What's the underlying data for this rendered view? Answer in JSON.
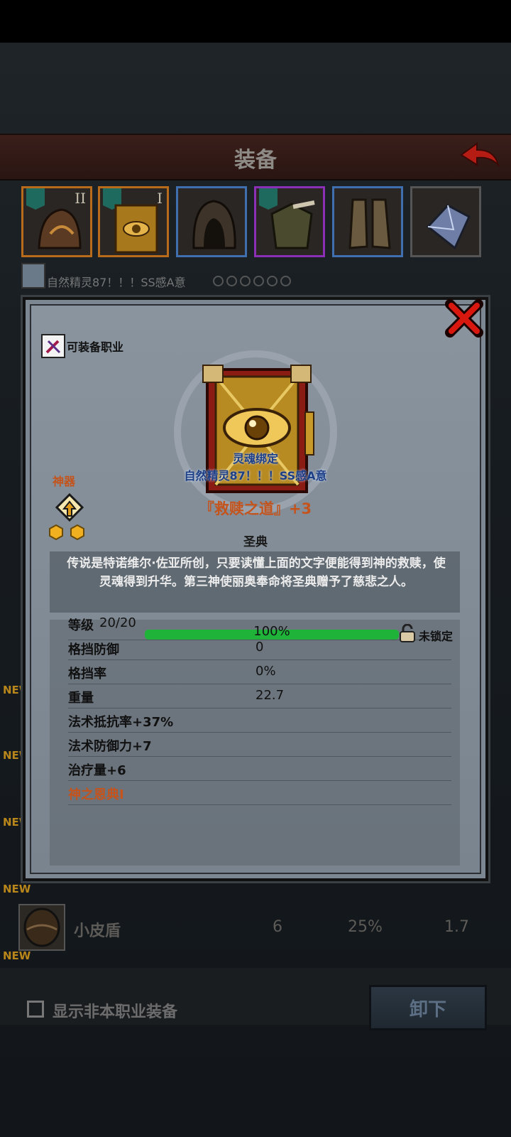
{
  "screen": {
    "title": "装备",
    "owner": {
      "name": "自然精灵87！！！SS感A意"
    }
  },
  "equipment_slots": [
    {
      "name": "helmet",
      "roman": "II",
      "border": "#b86b1a"
    },
    {
      "name": "book",
      "roman": "I",
      "border": "#b86b1a"
    },
    {
      "name": "hood",
      "roman": "",
      "border": "#3f6fae"
    },
    {
      "name": "armor",
      "roman": "",
      "border": "#8a2fb6"
    },
    {
      "name": "boots",
      "roman": "",
      "border": "#3f6fae"
    },
    {
      "name": "crystal",
      "roman": "",
      "border": "#555555"
    }
  ],
  "item": {
    "class_label": "可装备职业",
    "soulbind_label": "灵魂绑定",
    "soulbind_owner": "自然精灵87！！！SS感A意",
    "artifact_label": "神器",
    "name": "『救赎之道』+3",
    "type": "圣典",
    "description": "传说是特诺维尔·佐亚所创，只要读懂上面的文字便能得到神的救赎，使灵魂得到升华。第三神使丽奥奉命将圣典赠予了慈悲之人。",
    "level": {
      "label": "等级",
      "value": "20/20",
      "percent_text": "100%",
      "progress": 1.0,
      "lock_label": "未锁定"
    },
    "stats": [
      {
        "label": "格挡防御",
        "value": "0"
      },
      {
        "label": "格挡率",
        "value": "0%"
      },
      {
        "label": "重量",
        "value": "22.7"
      }
    ],
    "bonuses": [
      {
        "text": "法术抵抗率+37%",
        "highlight": false
      },
      {
        "text": "法术防御力+7",
        "highlight": false
      },
      {
        "text": "治疗量+6",
        "highlight": false
      },
      {
        "text": "神之恩典Ⅰ",
        "highlight": true
      }
    ]
  },
  "list": {
    "new_tag": "NEW",
    "row": {
      "name": "小皮盾",
      "defense": "6",
      "rate": "25%",
      "weight": "1.7"
    }
  },
  "footer": {
    "show_other_class_label": "显示非本职业装备",
    "unequip_label": "卸下"
  },
  "colors": {
    "accent_orange": "#c4531c",
    "bind_blue": "#1d3f86",
    "progress_green": "#1fb33a"
  }
}
